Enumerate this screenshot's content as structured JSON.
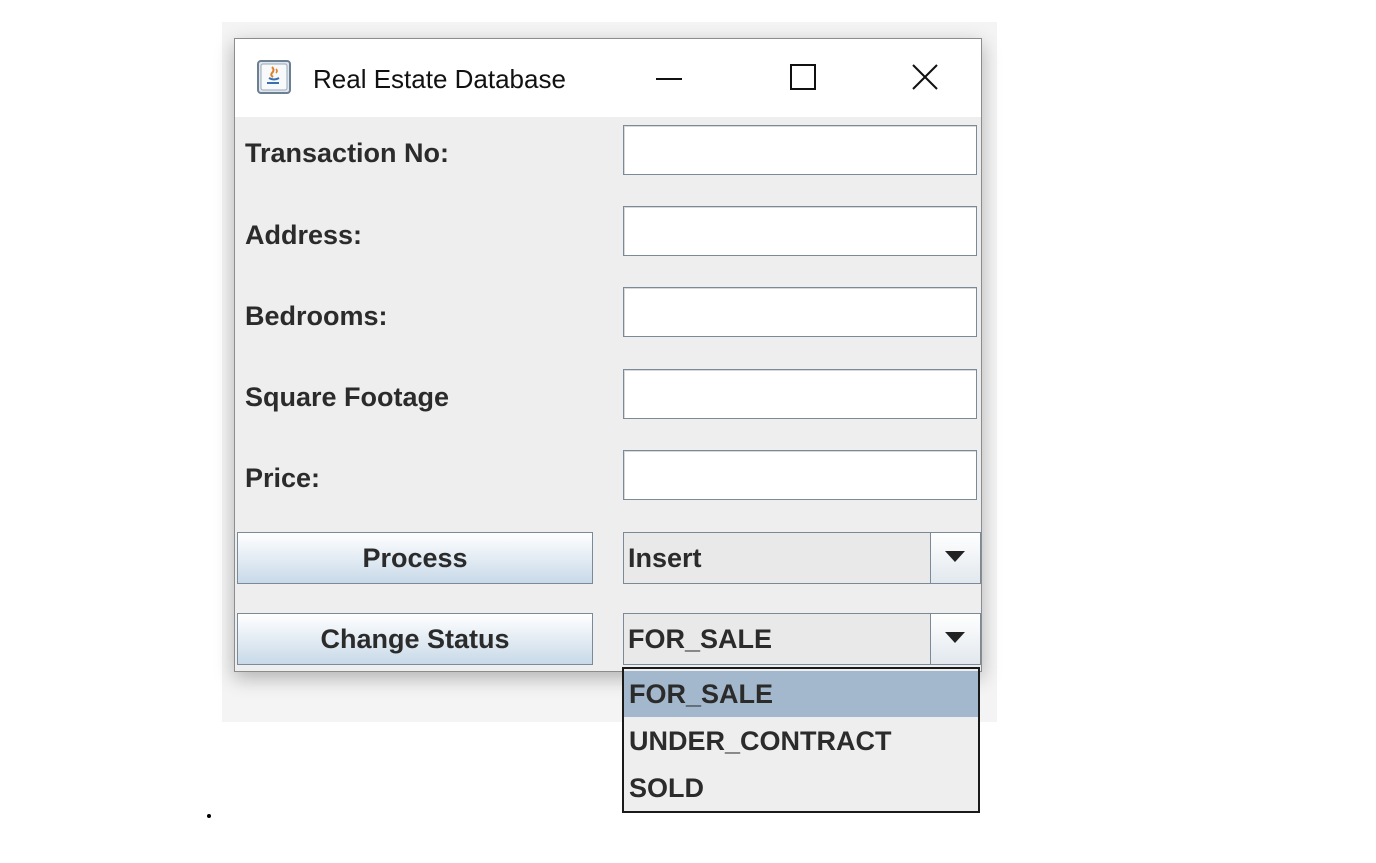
{
  "window": {
    "title": "Real Estate Database",
    "icon": "java-cup-icon",
    "controls": [
      "minimize-icon",
      "maximize-icon",
      "close-icon"
    ]
  },
  "form": {
    "fields": [
      {
        "label": "Transaction No:",
        "value": ""
      },
      {
        "label": "Address:",
        "value": ""
      },
      {
        "label": "Bedrooms:",
        "value": ""
      },
      {
        "label": "Square Footage",
        "value": ""
      },
      {
        "label": "Price:",
        "value": ""
      }
    ],
    "process_button": "Process",
    "operation_combo": {
      "selected": "Insert"
    },
    "change_status_button": "Change Status",
    "status_combo": {
      "selected": "FOR_SALE",
      "options": [
        "FOR_SALE",
        "UNDER_CONTRACT",
        "SOLD"
      ],
      "highlighted": "FOR_SALE"
    }
  },
  "colors": {
    "window_bg": "#eeeeee",
    "highlight": "#a3b8cc",
    "border": "#7a8a99"
  }
}
